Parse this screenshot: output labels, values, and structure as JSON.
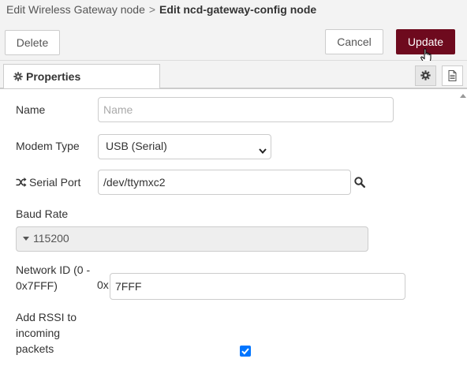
{
  "breadcrumb": {
    "parent": "Edit Wireless Gateway node",
    "separator": ">",
    "current": "Edit ncd-gateway-config node"
  },
  "toolbar": {
    "delete_label": "Delete",
    "cancel_label": "Cancel",
    "update_label": "Update"
  },
  "tabs": {
    "properties_label": "Properties"
  },
  "form": {
    "name": {
      "label": "Name",
      "value": "",
      "placeholder": "Name"
    },
    "modem_type": {
      "label": "Modem Type",
      "value": "USB (Serial)"
    },
    "serial_port": {
      "label": "Serial Port",
      "value": "/dev/ttymxc2"
    },
    "baud_rate": {
      "label": "Baud Rate",
      "value": "115200"
    },
    "network_id": {
      "label_line1": "Network ID (0 -",
      "label_line2": "0x7FFF)",
      "prefix": "0x",
      "value": "7FFF"
    },
    "rssi": {
      "label_line1": "Add RSSI to",
      "label_line2": "incoming",
      "label_line3": "packets",
      "checked": true
    }
  },
  "colors": {
    "accent": "#6e0a1e",
    "panel_bg": "#f3f3f3",
    "checkbox": "#0075ff"
  },
  "icons": [
    "gear-icon",
    "document-icon",
    "shuffle-icon",
    "search-icon",
    "hand-cursor-icon"
  ]
}
